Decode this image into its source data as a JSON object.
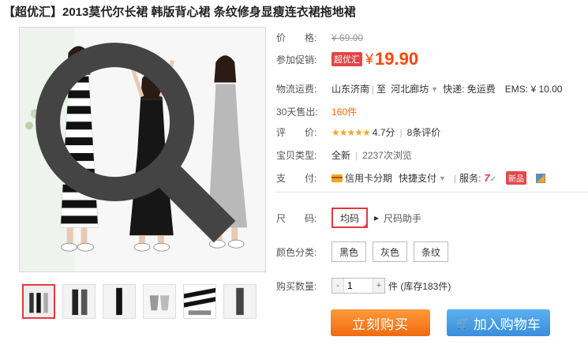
{
  "product": {
    "title": "【超优汇】2013莫代尔长裙 韩版背心裙 条纹修身显瘦连衣裙拖地裙"
  },
  "price": {
    "label": "价　　格:",
    "original": "¥ 69.00"
  },
  "promo": {
    "label": "参加促销:",
    "badge": "超优汇",
    "currency": "¥",
    "price": "19.90"
  },
  "shipping": {
    "label": "物流运费:",
    "from": "山东济南",
    "sep": "至",
    "to": "河北廊坊",
    "express": "快递: 免运费",
    "ems": "EMS: ¥ 10.00"
  },
  "sales": {
    "label": "30天售出:",
    "count": "160件"
  },
  "rating": {
    "label": "评　　价:",
    "stars": "★★★★★",
    "score": "4.7分",
    "reviews": "8条评价"
  },
  "item_type": {
    "label": "宝贝类型:",
    "condition": "全新",
    "views": "2237次浏览"
  },
  "payment": {
    "label": "支　　付:",
    "credit": "信用卡分期",
    "quick": "快捷支付",
    "service_label": "服务:",
    "new_badge": "新品"
  },
  "size": {
    "label": "尺　　码:",
    "options": [
      "均码"
    ],
    "helper": "尺码助手"
  },
  "color": {
    "label": "颜色分类:",
    "options": [
      "黑色",
      "灰色",
      "条纹"
    ]
  },
  "quantity": {
    "label": "购买数量:",
    "value": "1",
    "stock": "件 (库存183件)"
  },
  "actions": {
    "buy_now": "立刻购买",
    "add_cart": "加入购物车"
  },
  "colors": {
    "accent": "#f40",
    "buy": "#f37b1d",
    "cart": "#3a8ddb",
    "select": "#e4393c"
  },
  "icons": {
    "zoom": "magnifier-icon",
    "cart": "cart-icon",
    "caret": "caret-down-icon"
  }
}
